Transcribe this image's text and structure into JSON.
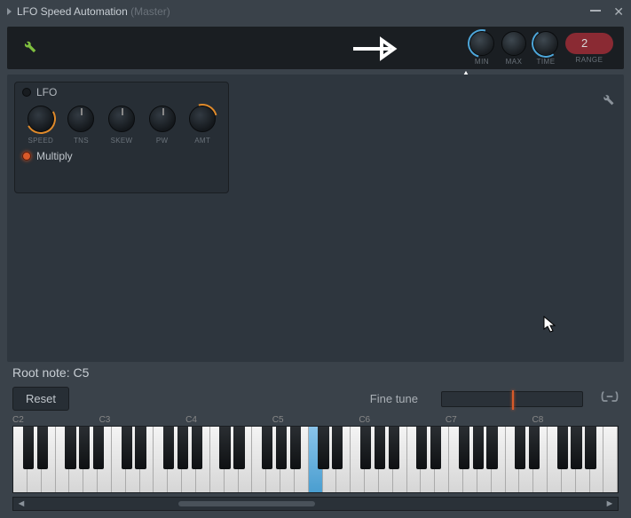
{
  "titlebar": {
    "title": "LFO Speed Automation",
    "suffix": "(Master)"
  },
  "toolbar": {
    "knobs": {
      "min": "MIN",
      "max": "MAX",
      "time": "TIME",
      "range": "RANGE"
    },
    "range_value": "2"
  },
  "lfo": {
    "header": "LFO",
    "knobs": {
      "speed": "SPEED",
      "tns": "TNS",
      "skew": "SKEW",
      "pw": "PW",
      "amt": "AMT"
    },
    "mode": "Multiply"
  },
  "bottom": {
    "root_note": "Root note: C5",
    "reset": "Reset",
    "fine_tune": "Fine tune",
    "octaves": [
      "C2",
      "C3",
      "C4",
      "C5",
      "C6",
      "C7",
      "C8"
    ]
  }
}
